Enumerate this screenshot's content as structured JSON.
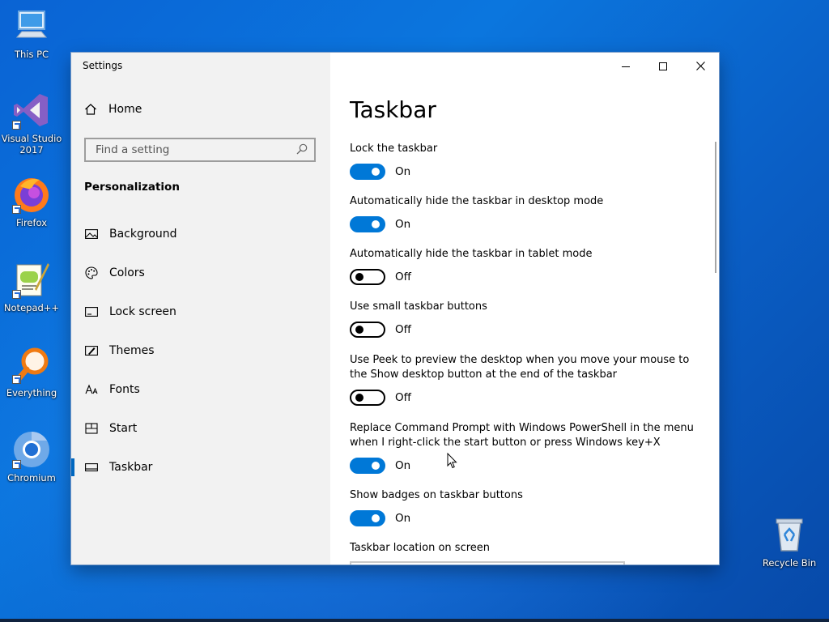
{
  "desktop": {
    "icons": [
      {
        "label": "This PC",
        "icon": "computer-icon"
      },
      {
        "label": "Visual Studio 2017",
        "icon": "visual-studio-icon"
      },
      {
        "label": "Firefox",
        "icon": "firefox-icon"
      },
      {
        "label": "Notepad++",
        "icon": "notepad-plus-plus-icon"
      },
      {
        "label": "Everything",
        "icon": "everything-search-icon"
      },
      {
        "label": "Chromium",
        "icon": "chromium-icon"
      },
      {
        "label": "Recycle Bin",
        "icon": "recycle-bin-icon"
      }
    ]
  },
  "window": {
    "title": "Settings",
    "controls": [
      "minimize-icon",
      "maximize-icon",
      "close-icon"
    ]
  },
  "sidebar": {
    "home_label": "Home",
    "search_placeholder": "Find a setting",
    "section_heading": "Personalization",
    "items": [
      {
        "label": "Background",
        "icon": "picture-icon",
        "active": false
      },
      {
        "label": "Colors",
        "icon": "palette-icon",
        "active": false
      },
      {
        "label": "Lock screen",
        "icon": "lock-screen-icon",
        "active": false
      },
      {
        "label": "Themes",
        "icon": "brush-icon",
        "active": false
      },
      {
        "label": "Fonts",
        "icon": "fonts-icon",
        "active": false
      },
      {
        "label": "Start",
        "icon": "start-tiles-icon",
        "active": false
      },
      {
        "label": "Taskbar",
        "icon": "taskbar-icon",
        "active": true
      }
    ]
  },
  "content": {
    "title": "Taskbar",
    "settings": [
      {
        "label": "Lock the taskbar",
        "on": true,
        "state": "On"
      },
      {
        "label": "Automatically hide the taskbar in desktop mode",
        "on": true,
        "state": "On"
      },
      {
        "label": "Automatically hide the taskbar in tablet mode",
        "on": false,
        "state": "Off"
      },
      {
        "label": "Use small taskbar buttons",
        "on": false,
        "state": "Off"
      },
      {
        "label": "Use Peek to preview the desktop when you move your mouse to the Show desktop button at the end of the taskbar",
        "on": false,
        "state": "Off"
      },
      {
        "label": "Replace Command Prompt with Windows PowerShell in the menu when I right-click the start button or press Windows key+X",
        "on": true,
        "state": "On"
      },
      {
        "label": "Show badges on taskbar buttons",
        "on": true,
        "state": "On"
      }
    ],
    "location_label": "Taskbar location on screen"
  },
  "colors": {
    "accent": "#0078d7",
    "sidebar_bg": "#f2f2f2",
    "desktop_blue": "#0b6fd9"
  }
}
